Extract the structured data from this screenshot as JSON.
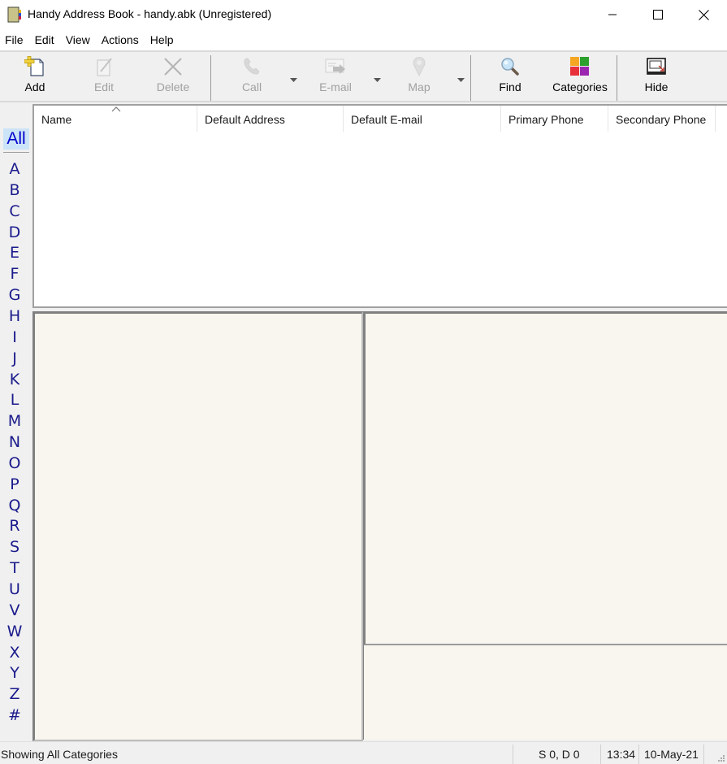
{
  "window": {
    "title": "Handy Address Book - handy.abk (Unregistered)",
    "controls": {
      "minimize": "minimize-icon",
      "maximize": "maximize-icon",
      "close": "close-icon"
    }
  },
  "menu": {
    "items": [
      "File",
      "Edit",
      "View",
      "Actions",
      "Help"
    ]
  },
  "toolbar": {
    "add": {
      "label": "Add",
      "icon": "add-contact-icon",
      "enabled": true
    },
    "edit": {
      "label": "Edit",
      "icon": "edit-icon",
      "enabled": false
    },
    "delete": {
      "label": "Delete",
      "icon": "delete-icon",
      "enabled": false
    },
    "call": {
      "label": "Call",
      "icon": "phone-icon",
      "enabled": false,
      "has_dropdown": true
    },
    "email": {
      "label": "E-mail",
      "icon": "email-icon",
      "enabled": false,
      "has_dropdown": true
    },
    "map": {
      "label": "Map",
      "icon": "map-pin-icon",
      "enabled": false,
      "has_dropdown": true
    },
    "find": {
      "label": "Find",
      "icon": "magnifier-icon",
      "enabled": true
    },
    "categories": {
      "label": "Categories",
      "icon": "categories-icon",
      "enabled": true,
      "colors": [
        "#f5a623",
        "#2ca02c",
        "#e8303a",
        "#9b27b0"
      ]
    },
    "hide": {
      "label": "Hide",
      "icon": "hide-window-icon",
      "enabled": true
    }
  },
  "alphabet": {
    "selected": "All",
    "letters": [
      "A",
      "B",
      "C",
      "D",
      "E",
      "F",
      "G",
      "H",
      "I",
      "J",
      "K",
      "L",
      "M",
      "N",
      "O",
      "P",
      "Q",
      "R",
      "S",
      "T",
      "U",
      "V",
      "W",
      "X",
      "Y",
      "Z",
      "#"
    ],
    "color": "#1a1a8c",
    "selected_bg": "#cce4f7"
  },
  "contacts_list": {
    "columns": [
      "Name",
      "Default Address",
      "Default E-mail",
      "Primary Phone",
      "Secondary Phone"
    ],
    "sort_column": "Name",
    "sort_direction": "ascending",
    "rows": []
  },
  "panes": {
    "background": "#f8f6ee"
  },
  "statusbar": {
    "message": "Showing All Categories",
    "counts": "S 0, D 0",
    "time": "13:34",
    "date": "10-May-21"
  }
}
